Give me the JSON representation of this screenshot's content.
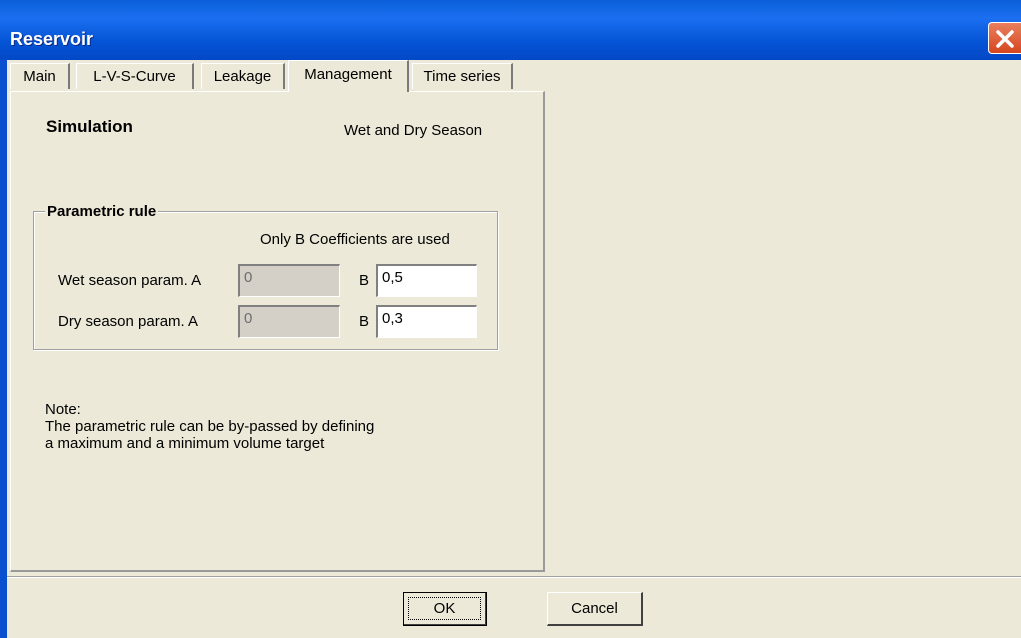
{
  "window": {
    "title": "Reservoir",
    "close_icon": "close-icon",
    "colors": {
      "titlebar": "#0554d6",
      "close": "#d6461f",
      "face": "#ece9d8"
    }
  },
  "tabs": [
    {
      "label": "Main",
      "active": false
    },
    {
      "label": "L-V-S-Curve",
      "active": false
    },
    {
      "label": "Leakage",
      "active": false
    },
    {
      "label": "Management",
      "active": true
    },
    {
      "label": "Time series",
      "active": false
    }
  ],
  "management": {
    "heading": "Simulation",
    "season_mode": "Wet and Dry Season",
    "parametric_rule": {
      "legend": "Parametric rule",
      "coefficient_note": "Only B Coefficients are used",
      "wet": {
        "label": "Wet season param. A",
        "a_value": "0",
        "b_label": "B",
        "b_value": "0,5"
      },
      "dry": {
        "label": "Dry season param. A",
        "a_value": "0",
        "b_label": "B",
        "b_value": "0,3"
      }
    },
    "note": {
      "line1": "Note:",
      "line2": "The parametric rule can be by-passed by defining",
      "line3": "a maximum and a minimum volume target"
    }
  },
  "buttons": {
    "ok": "OK",
    "cancel": "Cancel"
  }
}
